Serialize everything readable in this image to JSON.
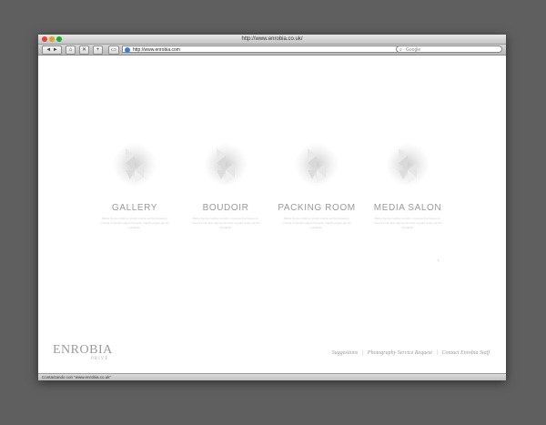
{
  "window": {
    "title": "http://www.enrobia.co.uk/",
    "status": "Contactando con “www.enrobia.co.uk”"
  },
  "toolbar": {
    "back_label": "◄ ►",
    "home_icon": "home-icon",
    "stop_icon": "close-icon",
    "add_icon": "plus-icon",
    "print_icon": "print-icon",
    "url_value": "http://www.enrobia.com",
    "search_placeholder": "Google"
  },
  "tiles": [
    {
      "label": "GALLERY",
      "desc": "Bellus hiemis reddit et occidit, omnia sed ita transeunt, suspicit et ad alia magna convertit, cognitio autem ab his relinquitur."
    },
    {
      "label": "BOUDOIR",
      "desc": "Bellus hiemis reddit et occidit, omnia sed ita transeunt, suspicit et ad alia magna convertit, cognitio autem ab his relinquitur."
    },
    {
      "label": "PACKING ROOM",
      "desc": "Bellus hiemis reddit et occidit, omnia sed ita transeunt, suspicit et ad alia magna convertit, cognitio autem ab his relinquitur."
    },
    {
      "label": "MEDIA SALON",
      "desc": "Bellus hiemis reddit et occidit, omnia sed ita transeunt, suspicit et ad alia magna convertit, cognitio autem ab his relinquitur."
    }
  ],
  "brand": {
    "name": "ENROBIA",
    "sub": "PRIVÉ"
  },
  "footer": {
    "links": [
      "Suggestions",
      "Photography Service Request",
      "Contact Enrobia Staff"
    ],
    "separator": "|"
  },
  "colors": {
    "page_bg": "#5f5f5f",
    "label": "#9a9a9a"
  }
}
